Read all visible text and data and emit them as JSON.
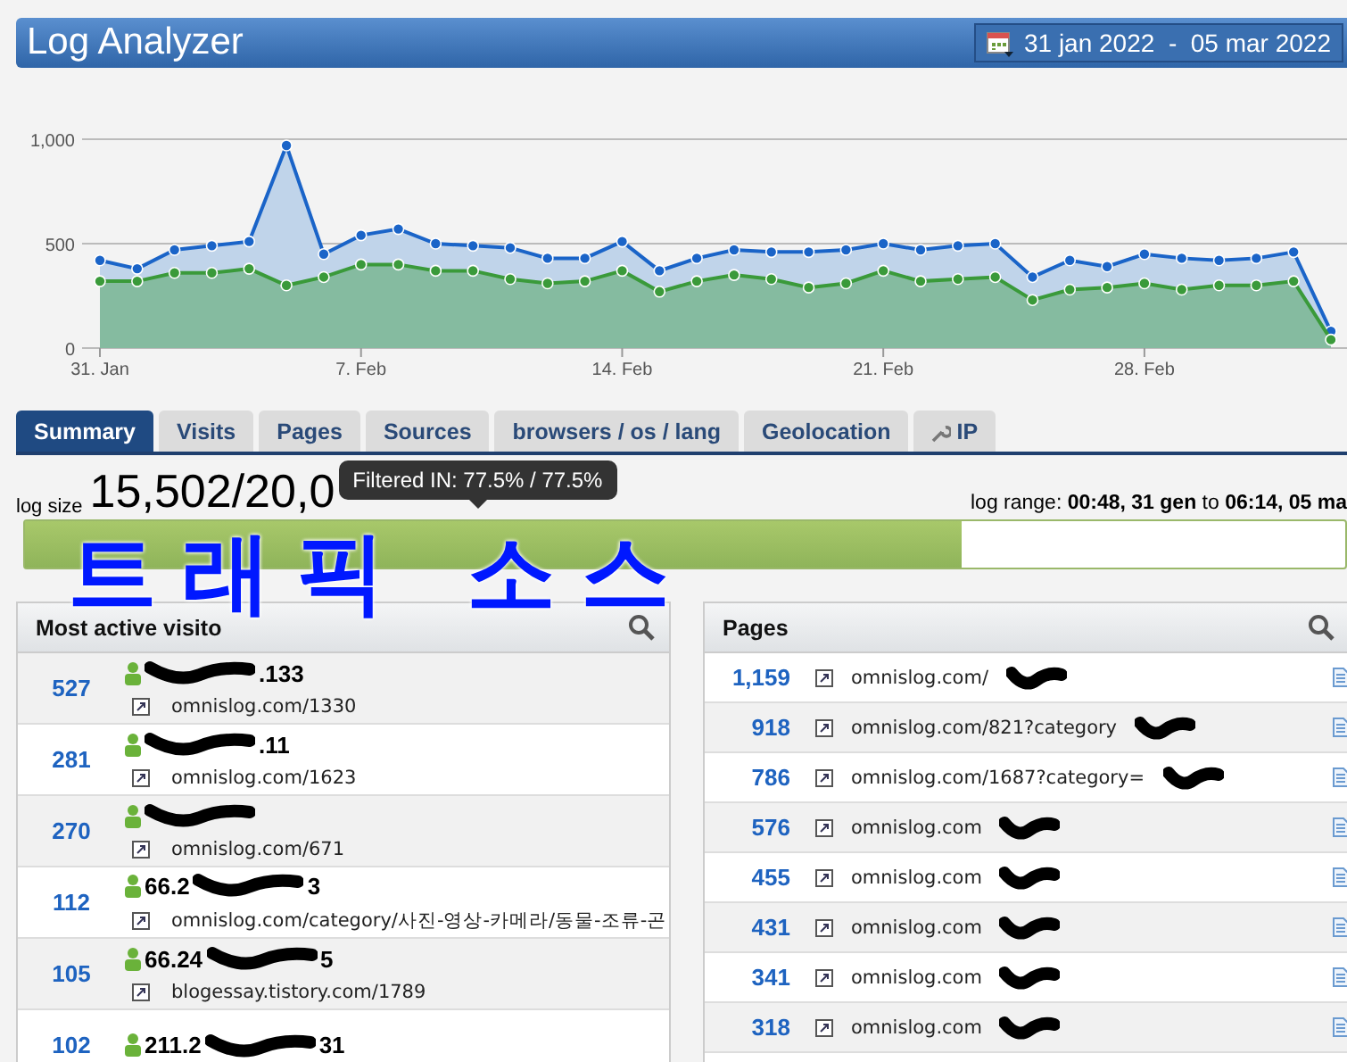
{
  "header": {
    "title": "Log Analyzer",
    "date_range": "31 jan 2022  -  05 mar 2022"
  },
  "traffic": {
    "chart_data": {
      "type": "area",
      "categories": [
        "31. Jan",
        null,
        null,
        null,
        null,
        null,
        null,
        "7. Feb",
        null,
        null,
        null,
        null,
        null,
        null,
        "14. Feb",
        null,
        null,
        null,
        null,
        null,
        null,
        "21. Feb",
        null,
        null,
        null,
        null,
        null,
        null,
        "28. Feb",
        null,
        null,
        null,
        null,
        null
      ],
      "series": [
        {
          "color": "#1a64c8",
          "values": [
            420,
            380,
            470,
            490,
            510,
            970,
            450,
            540,
            570,
            500,
            490,
            480,
            430,
            430,
            510,
            370,
            430,
            470,
            460,
            460,
            470,
            500,
            470,
            490,
            500,
            340,
            420,
            390,
            450,
            430,
            420,
            430,
            460,
            80
          ]
        },
        {
          "color": "#3a9a3a",
          "values": [
            320,
            320,
            360,
            360,
            380,
            300,
            340,
            400,
            400,
            370,
            370,
            330,
            310,
            320,
            370,
            270,
            320,
            350,
            330,
            290,
            310,
            370,
            320,
            330,
            340,
            230,
            280,
            290,
            310,
            280,
            300,
            300,
            320,
            40
          ]
        }
      ],
      "ylim": [
        0,
        1000
      ],
      "yticks": [
        {
          "value": 0,
          "label": "0"
        },
        {
          "value": 500,
          "label": "500"
        },
        {
          "value": 1000,
          "label": "1,000"
        }
      ]
    }
  },
  "tabs": [
    {
      "label": "Summary",
      "selected": true
    },
    {
      "label": "Visits",
      "selected": false
    },
    {
      "label": "Pages",
      "selected": false
    },
    {
      "label": "Sources",
      "selected": false
    },
    {
      "label": "browsers / os / lang",
      "selected": false
    },
    {
      "label": "Geolocation",
      "selected": false
    },
    {
      "label": "IP",
      "selected": false,
      "kind": "wrench"
    }
  ],
  "log": {
    "size_label": "log size",
    "size": "15,502/20,0",
    "tooltip": "Filtered IN: 77.5% / 77.5%",
    "range": "log range: **00:48, 31 gen** to **06:14, 05 ma**",
    "level": 0.71
  },
  "annotation": "트래픽 소스",
  "visitors": {
    "title": "Most active visito",
    "rows": [
      {
        "count": "527",
        "ip_start": "",
        "ip_end": ".133",
        "url": "omnislog.com/1330"
      },
      {
        "count": "281",
        "ip_start": "",
        "ip_end": ".11",
        "url": "omnislog.com/1623"
      },
      {
        "count": "270",
        "ip_start": "",
        "ip_end": "",
        "url": "omnislog.com/671"
      },
      {
        "count": "112",
        "ip_start": "66.2",
        "ip_end": "3",
        "url": "omnislog.com/category/사진-영상-카메라/동물-조류-곤"
      },
      {
        "count": "105",
        "ip_start": "66.24",
        "ip_end": "5",
        "url": "blogessay.tistory.com/1789"
      },
      {
        "count": "102",
        "ip_start": "211.2",
        "ip_end": "31",
        "url": ""
      }
    ]
  },
  "pages": {
    "title": "Pages",
    "rows": [
      {
        "count": "1,159",
        "url": "omnislog.com/"
      },
      {
        "count": "918",
        "url": "omnislog.com/821?category"
      },
      {
        "count": "786",
        "url": "omnislog.com/1687?category="
      },
      {
        "count": "576",
        "url": "omnislog.com"
      },
      {
        "count": "455",
        "url": "omnislog.com"
      },
      {
        "count": "431",
        "url": "omnislog.com"
      },
      {
        "count": "341",
        "url": "omnislog.com"
      },
      {
        "count": "318",
        "url": "omnislog.com"
      }
    ]
  }
}
